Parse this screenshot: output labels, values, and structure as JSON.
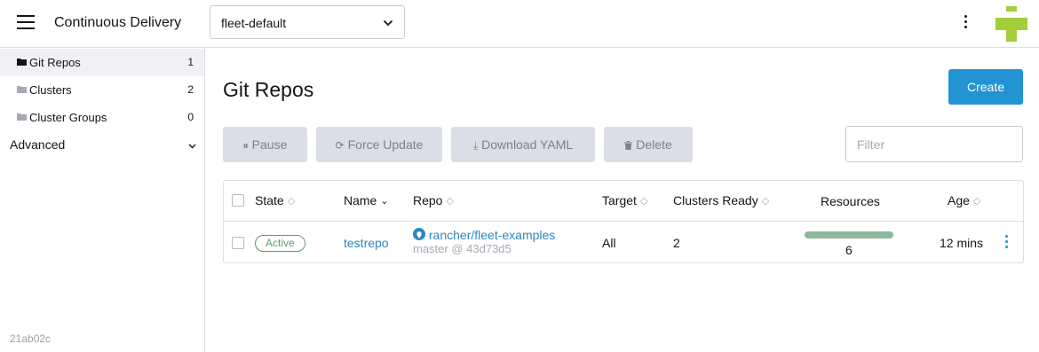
{
  "header": {
    "app_title": "Continuous Delivery",
    "namespace": "fleet-default"
  },
  "sidebar": {
    "items": [
      {
        "label": "Git Repos",
        "count": "1"
      },
      {
        "label": "Clusters",
        "count": "2"
      },
      {
        "label": "Cluster Groups",
        "count": "0"
      }
    ],
    "advanced_label": "Advanced",
    "version": "21ab02c"
  },
  "main": {
    "title": "Git Repos",
    "create_label": "Create",
    "actions": {
      "pause": "Pause",
      "force_update": "Force Update",
      "download_yaml": "Download YAML",
      "delete": "Delete"
    },
    "filter_placeholder": "Filter"
  },
  "table": {
    "headers": {
      "state": "State",
      "name": "Name",
      "repo": "Repo",
      "target": "Target",
      "clusters_ready": "Clusters Ready",
      "resources": "Resources",
      "age": "Age"
    },
    "rows": [
      {
        "state": "Active",
        "name": "testrepo",
        "repo": "rancher/fleet-examples",
        "branch_commit": "master @ 43d73d5",
        "target": "All",
        "clusters_ready": "2",
        "resources": "6",
        "age": "12 mins"
      }
    ]
  },
  "colors": {
    "accent": "#2294d2",
    "active_state": "#5e9b68",
    "resource_bar": "#8db99a",
    "logo_green": "#a3cd39"
  }
}
